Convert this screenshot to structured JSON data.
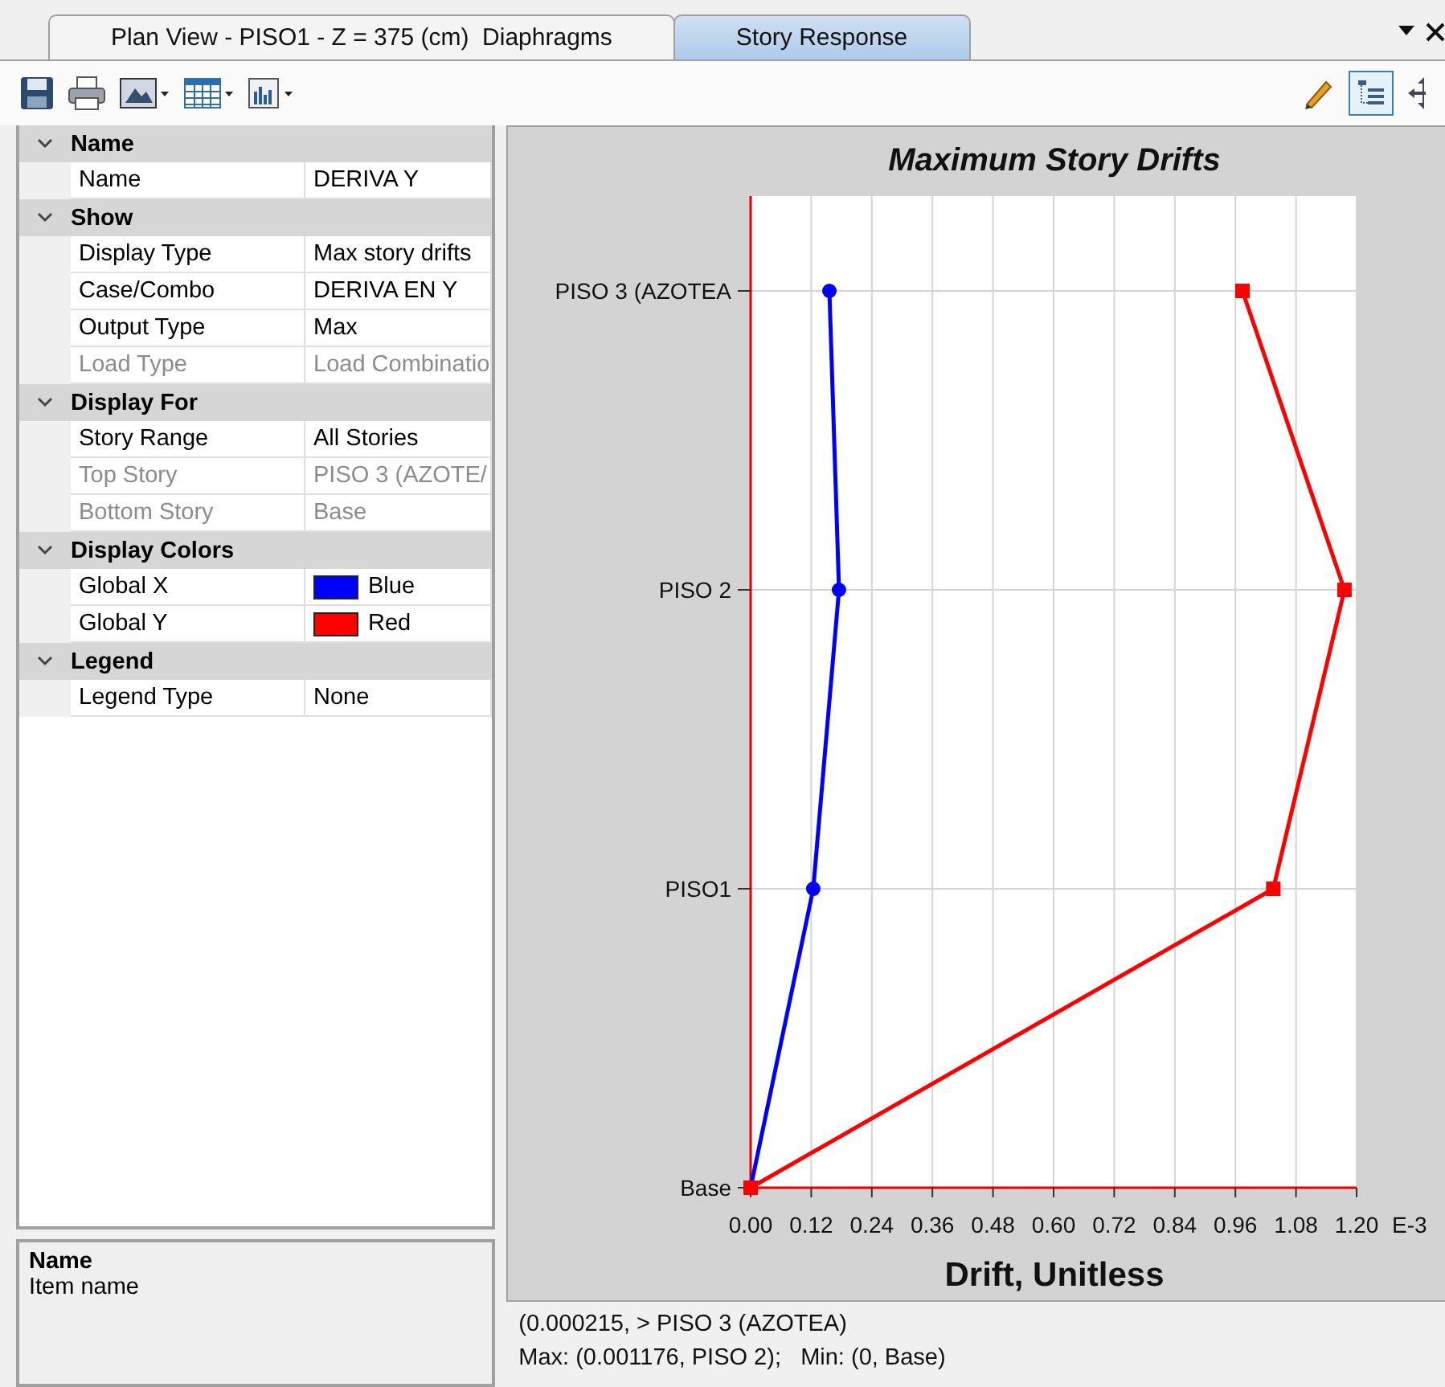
{
  "tabs": [
    {
      "label": "Plan View - PISO1 - Z = 375 (cm)  Diaphragms",
      "selected": false
    },
    {
      "label": "Story Response",
      "selected": true
    }
  ],
  "properties": [
    {
      "title": "Name",
      "expanded": true,
      "rows": [
        {
          "label": "Name",
          "value": "DERIVA Y",
          "disabled": false
        }
      ]
    },
    {
      "title": "Show",
      "expanded": true,
      "rows": [
        {
          "label": "Display Type",
          "value": "Max story drifts",
          "disabled": false
        },
        {
          "label": "Case/Combo",
          "value": "DERIVA EN Y",
          "disabled": false
        },
        {
          "label": "Output Type",
          "value": "Max",
          "disabled": false
        },
        {
          "label": "Load Type",
          "value": "Load Combinatio",
          "disabled": true
        }
      ]
    },
    {
      "title": "Display For",
      "expanded": true,
      "rows": [
        {
          "label": "Story Range",
          "value": "All Stories",
          "disabled": false
        },
        {
          "label": "Top Story",
          "value": "PISO 3 (AZOTE/",
          "disabled": true
        },
        {
          "label": "Bottom Story",
          "value": "Base",
          "disabled": true
        }
      ]
    },
    {
      "title": "Display Colors",
      "expanded": true,
      "rows": [
        {
          "label": "Global X",
          "value": "Blue",
          "disabled": false,
          "color": "#0000ff"
        },
        {
          "label": "Global Y",
          "value": "Red",
          "disabled": false,
          "color": "#ff0000"
        }
      ]
    },
    {
      "title": "Legend",
      "expanded": true,
      "rows": [
        {
          "label": "Legend Type",
          "value": "None",
          "disabled": false
        }
      ]
    }
  ],
  "description": {
    "title": "Name",
    "text": "Item name"
  },
  "chart": {
    "multiplier": "E-3",
    "chart_data": {
      "type": "line",
      "orientation": "horizontal",
      "title": "Maximum Story Drifts",
      "xlabel": "Drift, Unitless",
      "grid": true,
      "categories": [
        "PISO 3 (AZOTEA",
        "PISO 2",
        "PISO1",
        "Base"
      ],
      "series": [
        {
          "color": "#0000ff",
          "marker": "circle",
          "values": [
            0.156,
            0.175,
            0.124,
            0
          ]
        },
        {
          "color": "#ff0000",
          "marker": "square",
          "values": [
            0.974,
            1.176,
            1.035,
            0
          ]
        }
      ],
      "xlim": [
        0,
        1.2
      ],
      "xticks": [
        {
          "value": 0,
          "label": "0.00"
        },
        {
          "value": 0.12,
          "label": "0.12"
        },
        {
          "value": 0.24,
          "label": "0.24"
        },
        {
          "value": 0.36,
          "label": "0.36"
        },
        {
          "value": 0.48,
          "label": "0.48"
        },
        {
          "value": 0.6,
          "label": "0.60"
        },
        {
          "value": 0.72,
          "label": "0.72"
        },
        {
          "value": 0.84,
          "label": "0.84"
        },
        {
          "value": 0.96,
          "label": "0.96"
        },
        {
          "value": 1.08,
          "label": "1.08"
        },
        {
          "value": 1.2,
          "label": "1.20"
        }
      ]
    }
  },
  "status_lines": [
    "(0.000215, > PISO 3 (AZOTEA)",
    "Max: (0.001176, PISO 2);   Min: (0, Base)"
  ]
}
